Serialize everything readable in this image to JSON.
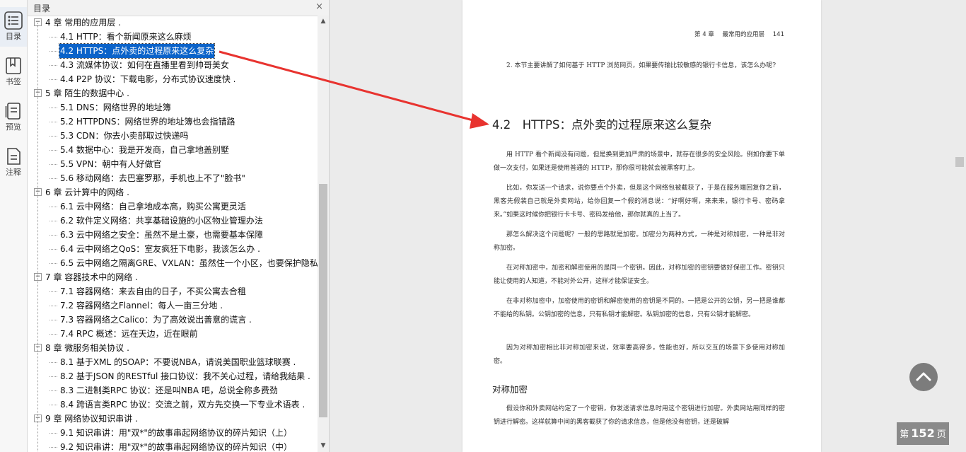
{
  "rail": [
    {
      "label": "目录",
      "icon": "list-icon"
    },
    {
      "label": "书签",
      "icon": "bookmark-icon"
    },
    {
      "label": "预览",
      "icon": "preview-icon"
    },
    {
      "label": "注释",
      "icon": "note-icon"
    }
  ],
  "toc": {
    "title": "目录",
    "close": "×",
    "items": [
      {
        "level": 0,
        "text": "4 章 常用的应用层 ."
      },
      {
        "level": 1,
        "text": "4.1 HTTP：看个新闻原来这么麻烦"
      },
      {
        "level": 1,
        "text": "4.2 HTTPS：点外卖的过程原来这么复杂",
        "selected": true
      },
      {
        "level": 1,
        "text": "4.3 流媒体协议：如何在直播里看到帅哥美女"
      },
      {
        "level": 1,
        "text": "4.4 P2P 协议：下载电影，分布式协议速度快 ."
      },
      {
        "level": 0,
        "text": "5 章 陌生的数据中心 ."
      },
      {
        "level": 1,
        "text": "5.1 DNS：网络世界的地址簿"
      },
      {
        "level": 1,
        "text": "5.2 HTTPDNS：网络世界的地址簿也会指错路"
      },
      {
        "level": 1,
        "text": "5.3 CDN：你去小卖部取过快递吗"
      },
      {
        "level": 1,
        "text": "5.4 数据中心：我是开发商，自己拿地盖别墅"
      },
      {
        "level": 1,
        "text": "5.5 VPN：朝中有人好做官"
      },
      {
        "level": 1,
        "text": "5.6 移动网络：去巴塞罗那，手机也上不了\"脸书\""
      },
      {
        "level": 0,
        "text": "6 章 云计算中的网络 ."
      },
      {
        "level": 1,
        "text": "6.1 云中网络：自己拿地成本高，购买公寓更灵活"
      },
      {
        "level": 1,
        "text": "6.2 软件定义网络：共享基础设施的小区物业管理办法"
      },
      {
        "level": 1,
        "text": "6.3 云中网络之安全：虽然不是土豪，也需要基本保障"
      },
      {
        "level": 1,
        "text": "6.4 云中网络之QoS：室友疯狂下电影，我该怎么办 ."
      },
      {
        "level": 1,
        "text": "6.5 云中网络之隔离GRE、VXLAN：虽然住一个小区，也要保护隐私"
      },
      {
        "level": 0,
        "text": "7 章 容器技术中的网络 ."
      },
      {
        "level": 1,
        "text": "7.1 容器网络：来去自由的日子，不买公寓去合租"
      },
      {
        "level": 1,
        "text": "7.2 容器网络之Flannel：每人一亩三分地 ."
      },
      {
        "level": 1,
        "text": "7.3 容器网络之Calico：为了高效说出善意的谎言 ."
      },
      {
        "level": 1,
        "text": "7.4 RPC 概述：远在天边，近在眼前"
      },
      {
        "level": 0,
        "text": "8 章 微服务相关协议 ."
      },
      {
        "level": 1,
        "text": "8.1 基于XML 的SOAP：不要说NBA，请说美国职业篮球联赛 ."
      },
      {
        "level": 1,
        "text": "8.2 基于JSON 的RESTful 接口协议：我不关心过程，请给我结果 ."
      },
      {
        "level": 1,
        "text": "8.3 二进制类RPC 协议：还是叫NBA 吧，总说全称多费劲"
      },
      {
        "level": 1,
        "text": "8.4 跨语言类RPC 协议：交流之前，双方先交换一下专业术语表 ."
      },
      {
        "level": 0,
        "text": "9 章 网络协议知识串讲 ."
      },
      {
        "level": 1,
        "text": "9.1 知识串讲：用\"双*\"的故事串起网络协议的碎片知识（上）"
      },
      {
        "level": 1,
        "text": "9.2 知识串讲：用\"双*\"的故事串起网络协议的碎片知识（中）"
      }
    ]
  },
  "page": {
    "running_chapter": "第 4 章",
    "running_title": "最常用的应用层",
    "running_page": "141",
    "question": "2. 本节主要讲解了如何基于 HTTP 浏览网页，如果要传输比较敏感的银行卡信息，该怎么办呢?",
    "section_title": "4.2　HTTPS：点外卖的过程原来这么复杂",
    "paragraphs": [
      "用 HTTP 看个新闻没有问题，但是换到更加严肃的场景中，就存在很多的安全风险。例如你要下单做一次支付，如果还是使用普通的 HTTP，那你很可能就会被黑客盯上。",
      "比如，你发送一个请求，说你要点个外卖，但是这个网络包被截获了，于是在服务端回复你之前，黑客先假装自己就是外卖网站，给你回复一个假的消息说：“好啊好啊，来来来，银行卡号、密码拿来。”如果这时候你把银行卡卡号、密码发给他，那你就真的上当了。",
      "那怎么解决这个问题呢？一般的思路就是加密。加密分为两种方式，一种是对称加密，一种是非对称加密。",
      "在对称加密中，加密和解密使用的是同一个密钥。因此，对称加密的密钥要做好保密工作。密钥只能让使用的人知道，不能对外公开，这样才能保证安全。",
      "在非对称加密中，加密使用的密钥和解密使用的密钥是不同的。一把是公开的公钥，另一把是谁都不能给的私钥。公钥加密的信息，只有私钥才能解密。私钥加密的信息，只有公钥才能解密。",
      "因为对称加密相比非对称加密来说，效率要高得多，性能也好，所以交互的场景下多使用对称加密。"
    ],
    "subsection_title": "对称加密",
    "last_paragraph": "假设你和外卖网站约定了一个密钥，你发送请求信息时用这个密钥进行加密。外卖网站用同样的密钥进行解密。这样就算中间的黑客截获了你的请求信息，但是他没有密钥，还是破解"
  },
  "status": {
    "prefix": "第",
    "page": "152",
    "suffix": "页"
  },
  "colors": {
    "selection": "#0b63c9",
    "arrow": "#e8332f"
  }
}
